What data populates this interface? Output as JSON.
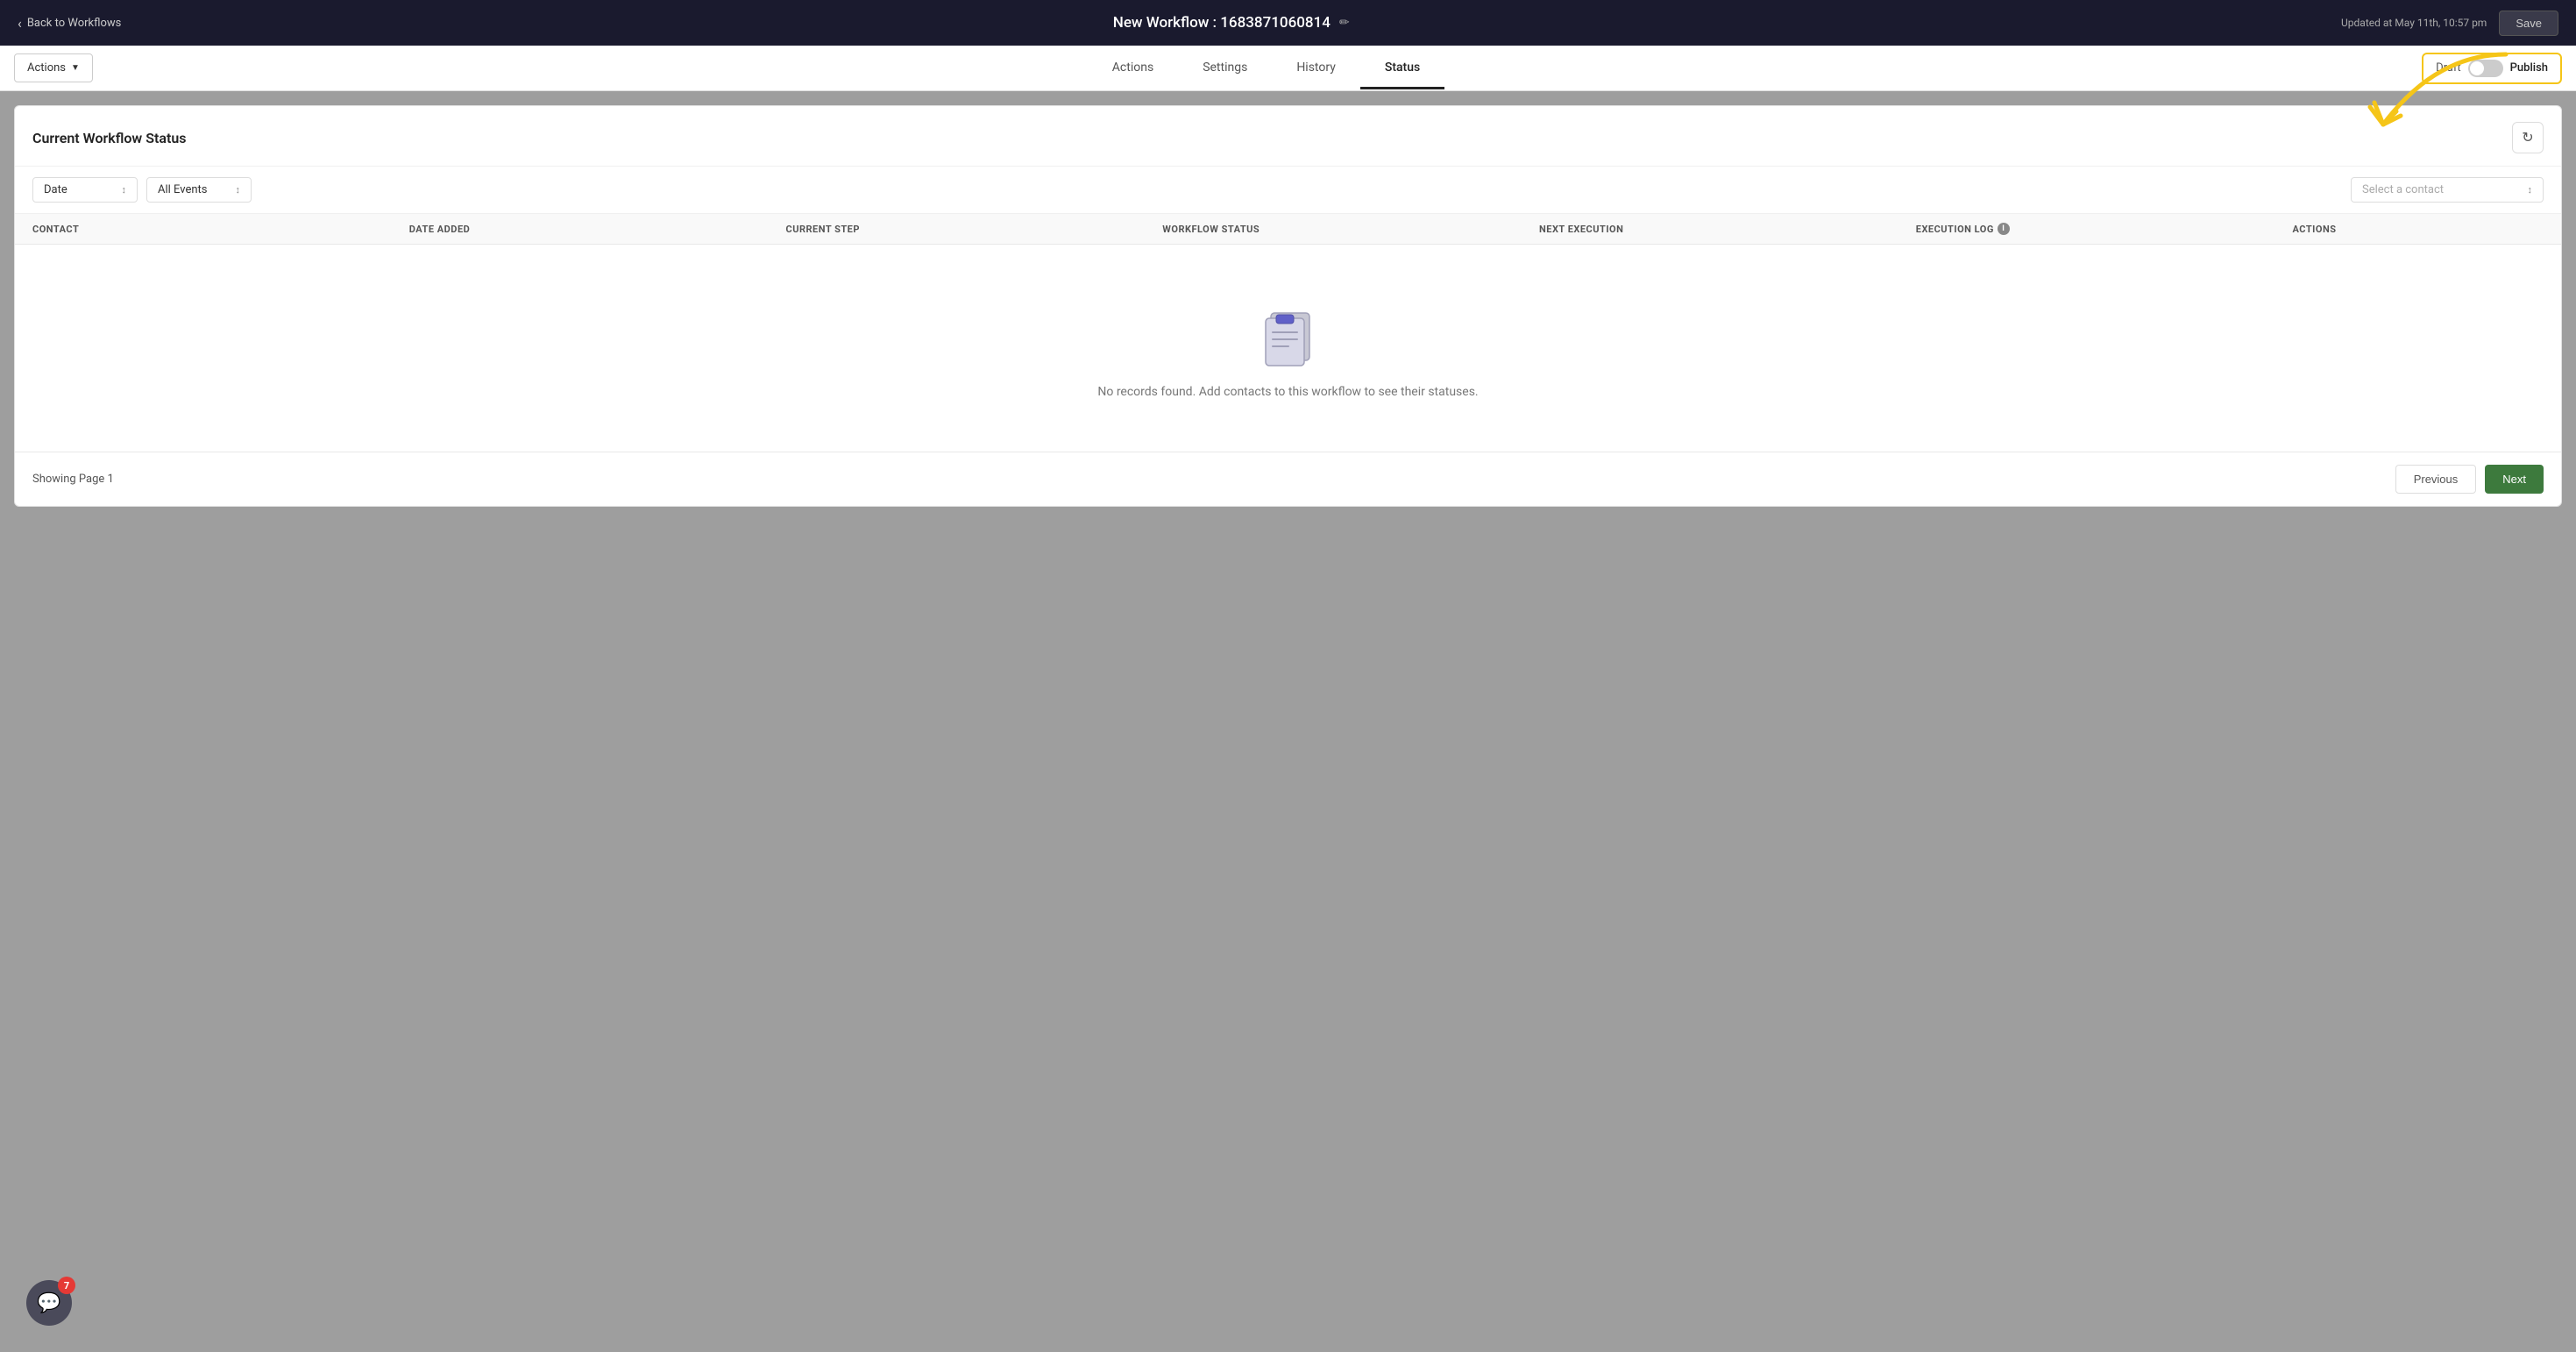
{
  "topBar": {
    "backLabel": "Back to Workflows",
    "workflowName": "New Workflow : 1683871060814",
    "updatedText": "Updated at May 11th, 10:57 pm",
    "saveLabel": "Save",
    "editIconLabel": "✏"
  },
  "subNav": {
    "actionsDropdown": "Actions",
    "tabs": [
      {
        "id": "actions",
        "label": "Actions",
        "active": false
      },
      {
        "id": "settings",
        "label": "Settings",
        "active": false
      },
      {
        "id": "history",
        "label": "History",
        "active": false
      },
      {
        "id": "status",
        "label": "Status",
        "active": true
      }
    ],
    "draftLabel": "Draft",
    "publishLabel": "Publish"
  },
  "mainContent": {
    "cardTitle": "Current Workflow Status",
    "filters": {
      "dateLabel": "Date",
      "eventsLabel": "All Events",
      "contactPlaceholder": "Select a contact"
    },
    "table": {
      "columns": [
        {
          "id": "contact",
          "label": "CONTACT"
        },
        {
          "id": "dateAdded",
          "label": "DATE ADDED"
        },
        {
          "id": "currentStep",
          "label": "CURRENT STEP"
        },
        {
          "id": "workflowStatus",
          "label": "WORKFLOW STATUS"
        },
        {
          "id": "nextExecution",
          "label": "NEXT EXECUTION"
        },
        {
          "id": "executionLog",
          "label": "EXECUTION LOG",
          "hasInfo": true
        },
        {
          "id": "actions",
          "label": "ACTIONS"
        }
      ]
    },
    "emptyState": {
      "text": "No records found. Add contacts to this workflow to see their statuses."
    },
    "pagination": {
      "pageInfo": "Showing Page 1",
      "prevLabel": "Previous",
      "nextLabel": "Next"
    }
  },
  "chatWidget": {
    "badge": "7"
  }
}
